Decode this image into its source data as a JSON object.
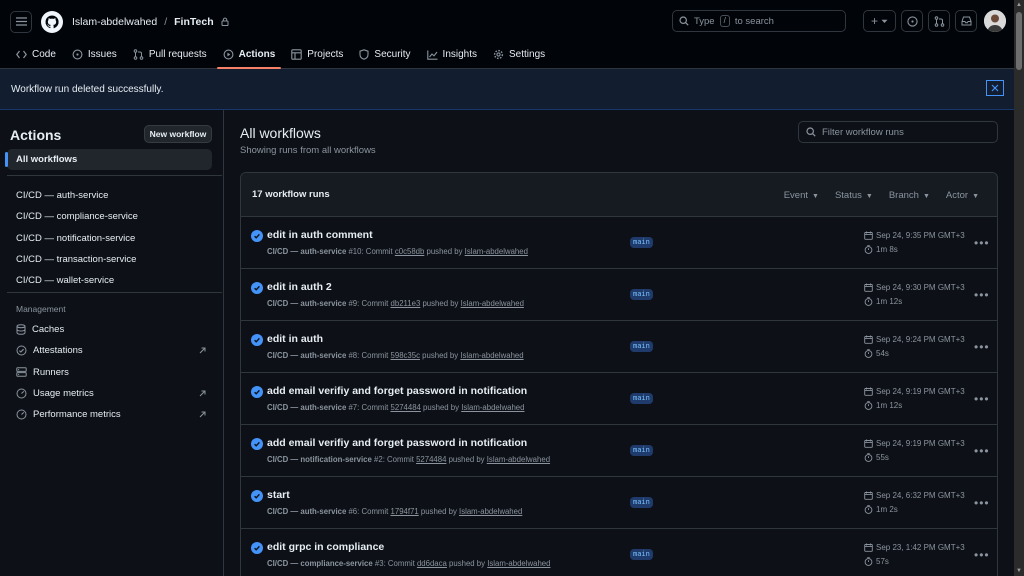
{
  "header": {
    "owner": "Islam-abdelwahed",
    "separator": "/",
    "repo": "FinTech",
    "search_type": "Type",
    "search_key": "/",
    "search_rest": "to search",
    "plus": "+"
  },
  "repo_nav": [
    {
      "label": "Code",
      "icon": "code-icon"
    },
    {
      "label": "Issues",
      "icon": "issue-icon"
    },
    {
      "label": "Pull requests",
      "icon": "pull-request-icon"
    },
    {
      "label": "Actions",
      "icon": "play-icon",
      "active": true
    },
    {
      "label": "Projects",
      "icon": "table-icon"
    },
    {
      "label": "Security",
      "icon": "shield-icon"
    },
    {
      "label": "Insights",
      "icon": "graph-icon"
    },
    {
      "label": "Settings",
      "icon": "gear-icon"
    }
  ],
  "flash": {
    "message": "Workflow run deleted successfully."
  },
  "sidebar": {
    "title": "Actions",
    "new_workflow": "New workflow",
    "all_workflows": "All workflows",
    "workflows": [
      "CI/CD — auth-service",
      "CI/CD — compliance-service",
      "CI/CD — notification-service",
      "CI/CD — transaction-service",
      "CI/CD — wallet-service"
    ],
    "management_title": "Management",
    "management": [
      {
        "label": "Caches",
        "icon": "database-icon",
        "external": false
      },
      {
        "label": "Attestations",
        "icon": "verified-icon",
        "external": true
      },
      {
        "label": "Runners",
        "icon": "server-icon",
        "external": false
      },
      {
        "label": "Usage metrics",
        "icon": "meter-icon",
        "external": true
      },
      {
        "label": "Performance metrics",
        "icon": "meter-icon",
        "external": true
      }
    ]
  },
  "main": {
    "title": "All workflows",
    "subtitle": "Showing runs from all workflows",
    "filter_placeholder": "Filter workflow runs",
    "runs_count": "17 workflow runs",
    "filters": [
      "Event",
      "Status",
      "Branch",
      "Actor"
    ]
  },
  "runs": [
    {
      "title": "edit in auth comment",
      "workflow": "CI/CD — auth-service",
      "run": "#10: Commit",
      "sha": "c0c58db",
      "pushed_by": "pushed by",
      "user": "Islam-abdelwahed",
      "branch": "main",
      "date": "Sep 24, 9:35 PM GMT+3",
      "duration": "1m 8s"
    },
    {
      "title": "edit in auth 2",
      "workflow": "CI/CD — auth-service",
      "run": "#9: Commit",
      "sha": "db211e3",
      "pushed_by": "pushed by",
      "user": "Islam-abdelwahed",
      "branch": "main",
      "date": "Sep 24, 9:30 PM GMT+3",
      "duration": "1m 12s"
    },
    {
      "title": "edit in auth",
      "workflow": "CI/CD — auth-service",
      "run": "#8: Commit",
      "sha": "598c35c",
      "pushed_by": "pushed by",
      "user": "Islam-abdelwahed",
      "branch": "main",
      "date": "Sep 24, 9:24 PM GMT+3",
      "duration": "54s"
    },
    {
      "title": "add email verifiy and forget password in notification",
      "workflow": "CI/CD — auth-service",
      "run": "#7: Commit",
      "sha": "5274484",
      "pushed_by": "pushed by",
      "user": "Islam-abdelwahed",
      "branch": "main",
      "date": "Sep 24, 9:19 PM GMT+3",
      "duration": "1m 12s"
    },
    {
      "title": "add email verifiy and forget password in notification",
      "workflow": "CI/CD — notification-service",
      "run": "#2: Commit",
      "sha": "5274484",
      "pushed_by": "pushed by",
      "user": "Islam-abdelwahed",
      "branch": "main",
      "date": "Sep 24, 9:19 PM GMT+3",
      "duration": "55s"
    },
    {
      "title": "start",
      "workflow": "CI/CD — auth-service",
      "run": "#6: Commit",
      "sha": "1794f71",
      "pushed_by": "pushed by",
      "user": "Islam-abdelwahed",
      "branch": "main",
      "date": "Sep 24, 6:32 PM GMT+3",
      "duration": "1m 2s"
    },
    {
      "title": "edit grpc in compliance",
      "workflow": "CI/CD — compliance-service",
      "run": "#3: Commit",
      "sha": "dd6daca",
      "pushed_by": "pushed by",
      "user": "Islam-abdelwahed",
      "branch": "main",
      "date": "Sep 23, 1:42 PM GMT+3",
      "duration": "57s"
    }
  ],
  "colors": {
    "accent": "#4493f8",
    "active_tab": "#f78166",
    "background": "#0d1117"
  }
}
